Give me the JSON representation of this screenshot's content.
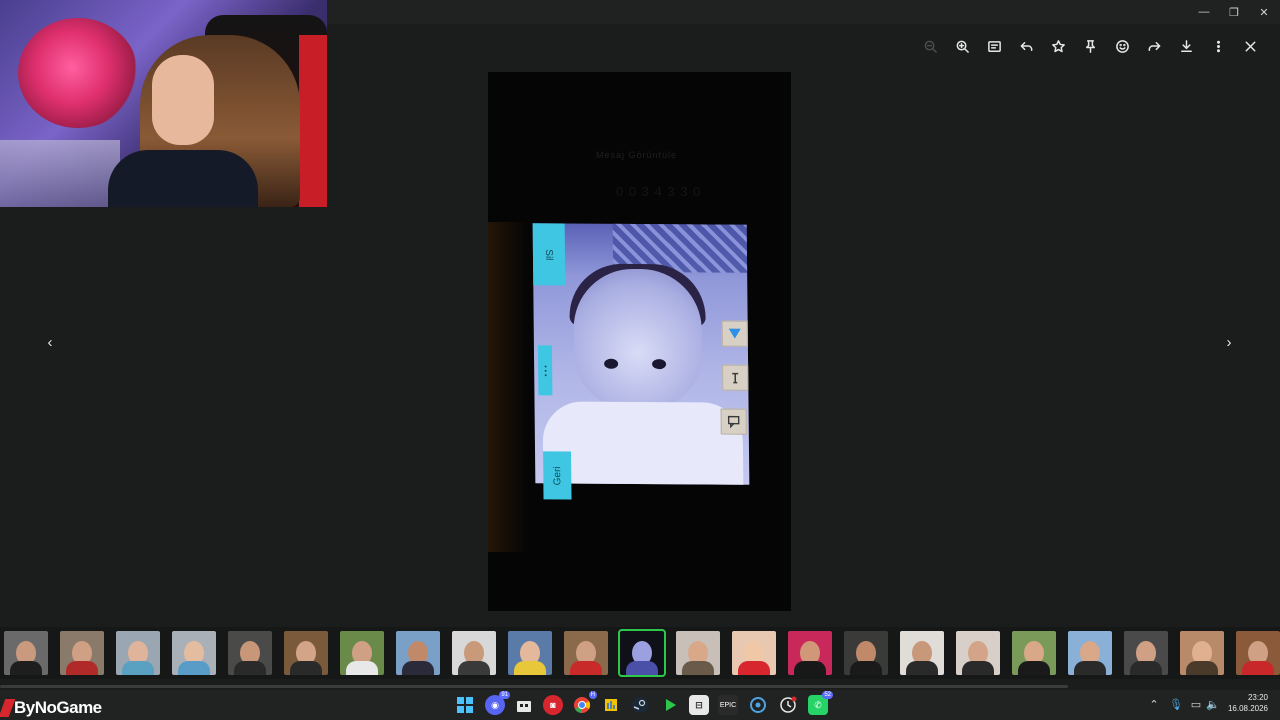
{
  "viewer": {
    "toolbar": [
      {
        "name": "zoom-out-icon",
        "dim": true
      },
      {
        "name": "zoom-in-icon"
      },
      {
        "name": "info-icon"
      },
      {
        "name": "reply-icon"
      },
      {
        "name": "star-icon"
      },
      {
        "name": "pin-icon"
      },
      {
        "name": "emoji-icon"
      },
      {
        "name": "forward-icon"
      },
      {
        "name": "download-icon"
      },
      {
        "name": "more-icon"
      },
      {
        "name": "close-icon"
      }
    ],
    "nav_prev": "‹",
    "nav_next": "›"
  },
  "window_controls": {
    "minimize": "—",
    "restore": "❐",
    "close": "✕"
  },
  "photo": {
    "blur_text_top": "Mesaj Görüntüle",
    "blur_text_mid": "0 0 3 4 3 3 0",
    "tab_top": "Sil",
    "tab_bottom": "Geri",
    "tab_side": "• • •"
  },
  "filmstrip": {
    "thumb_count": 23,
    "selected_index": 11
  },
  "taskbar": {
    "brand": "ByNoGame",
    "badges": {
      "discord": "91",
      "chrome": "H",
      "whatsapp": "52"
    }
  },
  "clock": {
    "time": "23:20",
    "date": "16.08.2026"
  },
  "colors": {
    "accent_selected": "#2dc84a",
    "brand_red": "#d8262e",
    "cyan": "#3fc6e3"
  }
}
